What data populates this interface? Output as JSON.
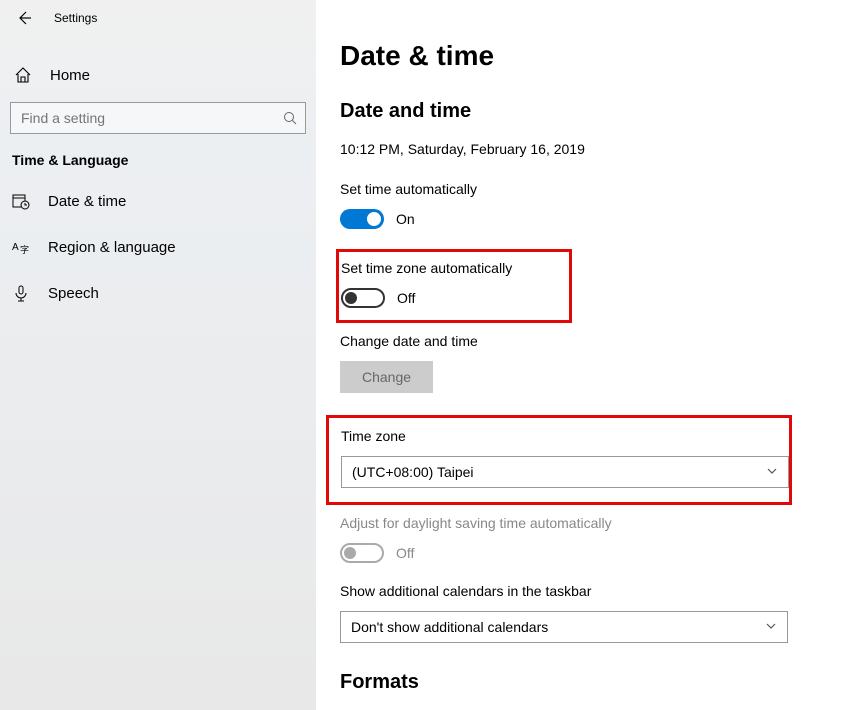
{
  "header": {
    "window_title": "Settings"
  },
  "sidebar": {
    "home_label": "Home",
    "search_placeholder": "Find a setting",
    "category": "Time & Language",
    "items": [
      {
        "label": "Date & time"
      },
      {
        "label": "Region & language"
      },
      {
        "label": "Speech"
      }
    ]
  },
  "main": {
    "page_title": "Date & time",
    "section_title": "Date and time",
    "current_datetime": "10:12 PM, Saturday, February 16, 2019",
    "set_time_auto_label": "Set time automatically",
    "set_time_auto_state": "On",
    "set_tz_auto_label": "Set time zone automatically",
    "set_tz_auto_state": "Off",
    "change_dt_label": "Change date and time",
    "change_btn": "Change",
    "tz_label": "Time zone",
    "tz_value": "(UTC+08:00) Taipei",
    "dst_label": "Adjust for daylight saving time automatically",
    "dst_state": "Off",
    "addl_cal_label": "Show additional calendars in the taskbar",
    "addl_cal_value": "Don't show additional calendars",
    "formats_title": "Formats"
  }
}
